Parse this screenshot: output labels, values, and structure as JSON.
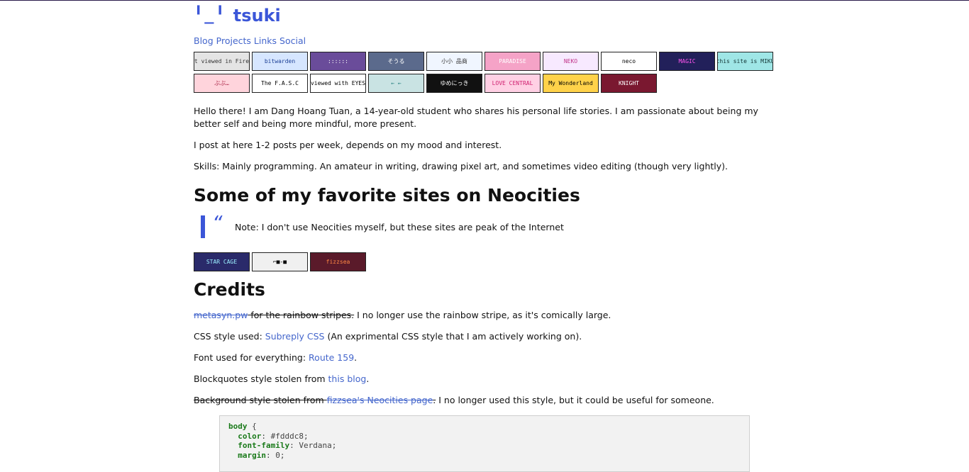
{
  "header": {
    "logo_face": "╹_╹",
    "title": "tsuki",
    "nav": [
      "Blog",
      "Projects",
      "Links",
      "Social"
    ]
  },
  "buttons88": [
    {
      "text": "Best viewed in Firefox",
      "bg": "#e4e4e4",
      "fg": "#333333"
    },
    {
      "text": "bitwarden",
      "bg": "#d6e6ff",
      "fg": "#1c3f95"
    },
    {
      "text": "::::::",
      "bg": "#6a4c9a",
      "fg": "#ffffff"
    },
    {
      "text": "そうる",
      "bg": "#5b6a8c",
      "fg": "#ffffff"
    },
    {
      "text": "小小 品商",
      "bg": "#f0f6ff",
      "fg": "#333333"
    },
    {
      "text": "PARADISE",
      "bg": "#f5a3c7",
      "fg": "#ffffff"
    },
    {
      "text": "NEKO",
      "bg": "#f7e9ff",
      "fg": "#c03388"
    },
    {
      "text": "neco",
      "bg": "#ffffff",
      "fg": "#000000"
    },
    {
      "text": "MAGIC",
      "bg": "#22205a",
      "fg": "#ff55ee"
    },
    {
      "text": "this site is MIKU",
      "bg": "#9fe6e6",
      "fg": "#113333"
    },
    {
      "text": "ぶぶ…",
      "bg": "#ffd4dc",
      "fg": "#aa2244"
    },
    {
      "text": "The F.A.S.C",
      "bg": "#ffffff",
      "fg": "#000000"
    },
    {
      "text": "viewed with EYES",
      "bg": "#ffffff",
      "fg": "#000000"
    },
    {
      "text": "← ←",
      "bg": "#c9e3e3",
      "fg": "#1a7a7a"
    },
    {
      "text": "ゆめにっき",
      "bg": "#111111",
      "fg": "#ffffff"
    },
    {
      "text": "LOVE CENTRAL",
      "bg": "#ffd0e4",
      "fg": "#d02070"
    },
    {
      "text": "My Wonderland",
      "bg": "#ffd24a",
      "fg": "#000000"
    },
    {
      "text": "KNIGHT",
      "bg": "#7a1830",
      "fg": "#ffffff"
    }
  ],
  "intro": [
    "Hello there! I am Dang Hoang Tuan, a 14-year-old student who shares his personal life stories. I am passionate about being my better self and being more mindful, more present.",
    "I post at here 1-2 posts per week, depends on my mood and interest.",
    "Skills: Mainly programming. An amateur in writing, drawing pixel art, and sometimes video editing (though very lightly)."
  ],
  "favorites": {
    "heading": "Some of my favorite sites on Neocities",
    "quote_mark": "“",
    "quote": "Note: I don't use Neocities myself, but these sites are peak of the Internet",
    "buttons": [
      {
        "text": "STAR CAGE",
        "bg": "#2a2a6a",
        "fg": "#9cf0ff"
      },
      {
        "text": "⌐■-■",
        "bg": "#f0f0f0",
        "fg": "#000000"
      },
      {
        "text": "fizzsea",
        "bg": "#5a1a2a",
        "fg": "#ff8844"
      }
    ]
  },
  "credits": {
    "heading": "Credits",
    "line1": {
      "link": "metasyn.pw",
      "struck": " for the rainbow stripes.",
      "rest": " I no longer use the rainbow stripe, as it's comically large."
    },
    "line2": {
      "prefix": "CSS style used: ",
      "link": "Subreply CSS",
      "suffix": " (An exprimental CSS style that I am actively working on)."
    },
    "line3": {
      "prefix": "Font used for everything: ",
      "link": "Route 159",
      "suffix": "."
    },
    "line4": {
      "prefix": "Blockquotes style stolen from ",
      "link": "this blog",
      "suffix": "."
    },
    "line5": {
      "struck": "Background style stolen from ",
      "link": "fizzsea's Neocities page",
      "struck2": ".",
      "rest": " I no longer used this style, but it could be useful for someone."
    }
  },
  "code": {
    "selector": "body",
    "open": " {",
    "lines": [
      {
        "prop": "color",
        "value": ": #fdddc8;"
      },
      {
        "prop": "font-family",
        "value": ": Verdana;"
      },
      {
        "prop": "margin",
        "value": ": 0;"
      }
    ]
  },
  "colors": {
    "accent": "#3b56d8",
    "link": "#4466cc"
  }
}
